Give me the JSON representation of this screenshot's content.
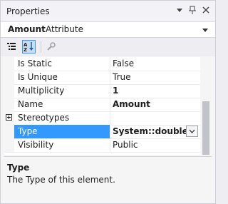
{
  "window": {
    "title": "Properties",
    "buttons": [
      "dropdown",
      "pin",
      "close"
    ]
  },
  "object": {
    "name": "Amount",
    "type": "Attribute"
  },
  "toolbar": {
    "buttons": [
      "categorized-icon",
      "alphabetical-icon",
      "property-pages-icon"
    ]
  },
  "properties": [
    {
      "name": "Is Static",
      "value": "False",
      "bold": false
    },
    {
      "name": "Is Unique",
      "value": "True",
      "bold": false
    },
    {
      "name": "Multiplicity",
      "value": "1",
      "bold": true
    },
    {
      "name": "Name",
      "value": "Amount",
      "bold": true
    },
    {
      "name": "Stereotypes",
      "value": "",
      "expandable": true
    },
    {
      "name": "Type",
      "value": "System::double",
      "bold": true,
      "selected": true
    },
    {
      "name": "Visibility",
      "value": "Public",
      "bold": false
    }
  ],
  "description": {
    "title": "Type",
    "text": "The Type of this element."
  },
  "colors": {
    "selection": "#3399ff",
    "panel": "#f5f5f5",
    "chrome": "#eeeef2"
  }
}
